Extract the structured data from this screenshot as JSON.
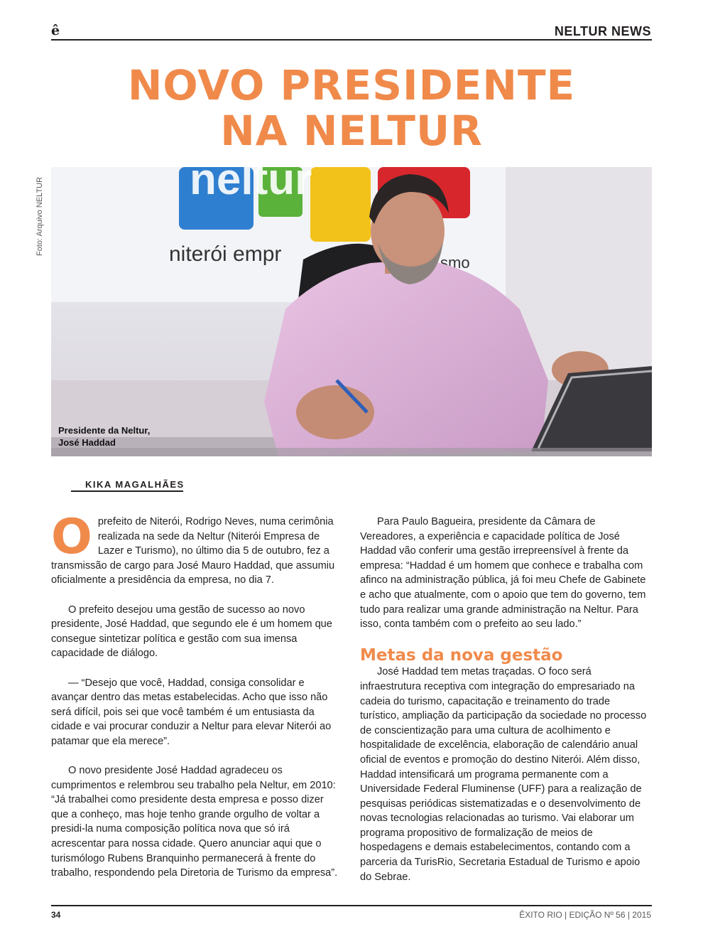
{
  "header": {
    "logo": "ê",
    "section": "NELTUR NEWS"
  },
  "headline": {
    "line1": "NOVO PRESIDENTE",
    "line2": "NA NELTUR"
  },
  "photo": {
    "credit": "Foto: Arquivo NELTUR",
    "caption_line1": "Presidente da Neltur,",
    "caption_line2": "José Haddad",
    "wall_text": "niterói empr",
    "wall_text_end": "smo",
    "sign_text": "neltur"
  },
  "byline": "KIKA MAGALHÃES",
  "article": {
    "dropcap": "O",
    "p1": "prefeito de Niterói, Rodrigo Neves, numa cerimônia realizada na sede da Neltur (Niterói Empresa de Lazer e Turismo), no último dia 5 de outubro, fez a transmissão de cargo para José Mauro Haddad, que assumiu oficialmente a presidência da empresa, no dia 7.",
    "p2": "O prefeito desejou uma gestão de sucesso ao novo presidente, José Haddad, que segundo ele é um homem que consegue sintetizar política e gestão com sua imensa capacidade de diálogo.",
    "p3": "— “Desejo que você, Haddad, consiga consolidar e avançar dentro das metas estabelecidas. Acho que isso não será difícil, pois sei que você também é um entusiasta da cidade e vai procurar conduzir a Neltur para elevar Niterói ao patamar que ela merece”.",
    "p4": "O novo presidente José Haddad agradeceu os cumprimentos e relembrou seu trabalho pela Neltur, em 2010: “Já trabalhei como presidente desta empresa e posso dizer que a conheço, mas hoje tenho grande orgulho de voltar a presidi-la numa composição política nova que só irá acrescentar para nossa cidade. Quero anunciar aqui que o turismólogo Rubens Branquinho permanecerá à frente do trabalho, respondendo pela Diretoria de Turismo da empresa”.",
    "p5": "Para Paulo Bagueira, presidente da Câmara de Vereadores, a experiência e capacidade política de José Haddad vão conferir uma gestão irrepreensível à frente da empresa: “Haddad é um homem que conhece e trabalha com afinco na administração pública, já foi meu Chefe de Gabinete e acho que atualmente, com o apoio que tem do governo, tem tudo para realizar uma grande administração na Neltur. Para isso, conta também com o prefeito ao seu lado.”",
    "subhead": "Metas da nova gestão",
    "p6": "José Haddad tem metas traçadas. O foco será infraestrutura receptiva com integração do empresariado na cadeia do turismo, capacitação e treinamento do trade turístico, ampliação da participação da sociedade no processo de conscientização para uma cultura de acolhimento e hospitalidade de excelência, elaboração de calendário anual oficial de eventos e promoção do destino Niterói. Além disso, Haddad intensificará um programa permanente com a Universidade Federal Fluminense (UFF) para a realização de pesquisas periódicas sistematizadas e o desenvolvimento de novas tecnologias relacionadas ao turismo. Vai elaborar um programa propositivo de formalização de meios de hospedagens e demais estabelecimentos, contando com a parceria da TurisRio, Secretaria Estadual de Turismo e apoio do Sebrae."
  },
  "footer": {
    "page_number": "34",
    "publication": "ÊXITO RIO | EDIÇÃO Nº 56 | 2015"
  },
  "colors": {
    "accent": "#f08a4b",
    "text": "#231f20"
  }
}
